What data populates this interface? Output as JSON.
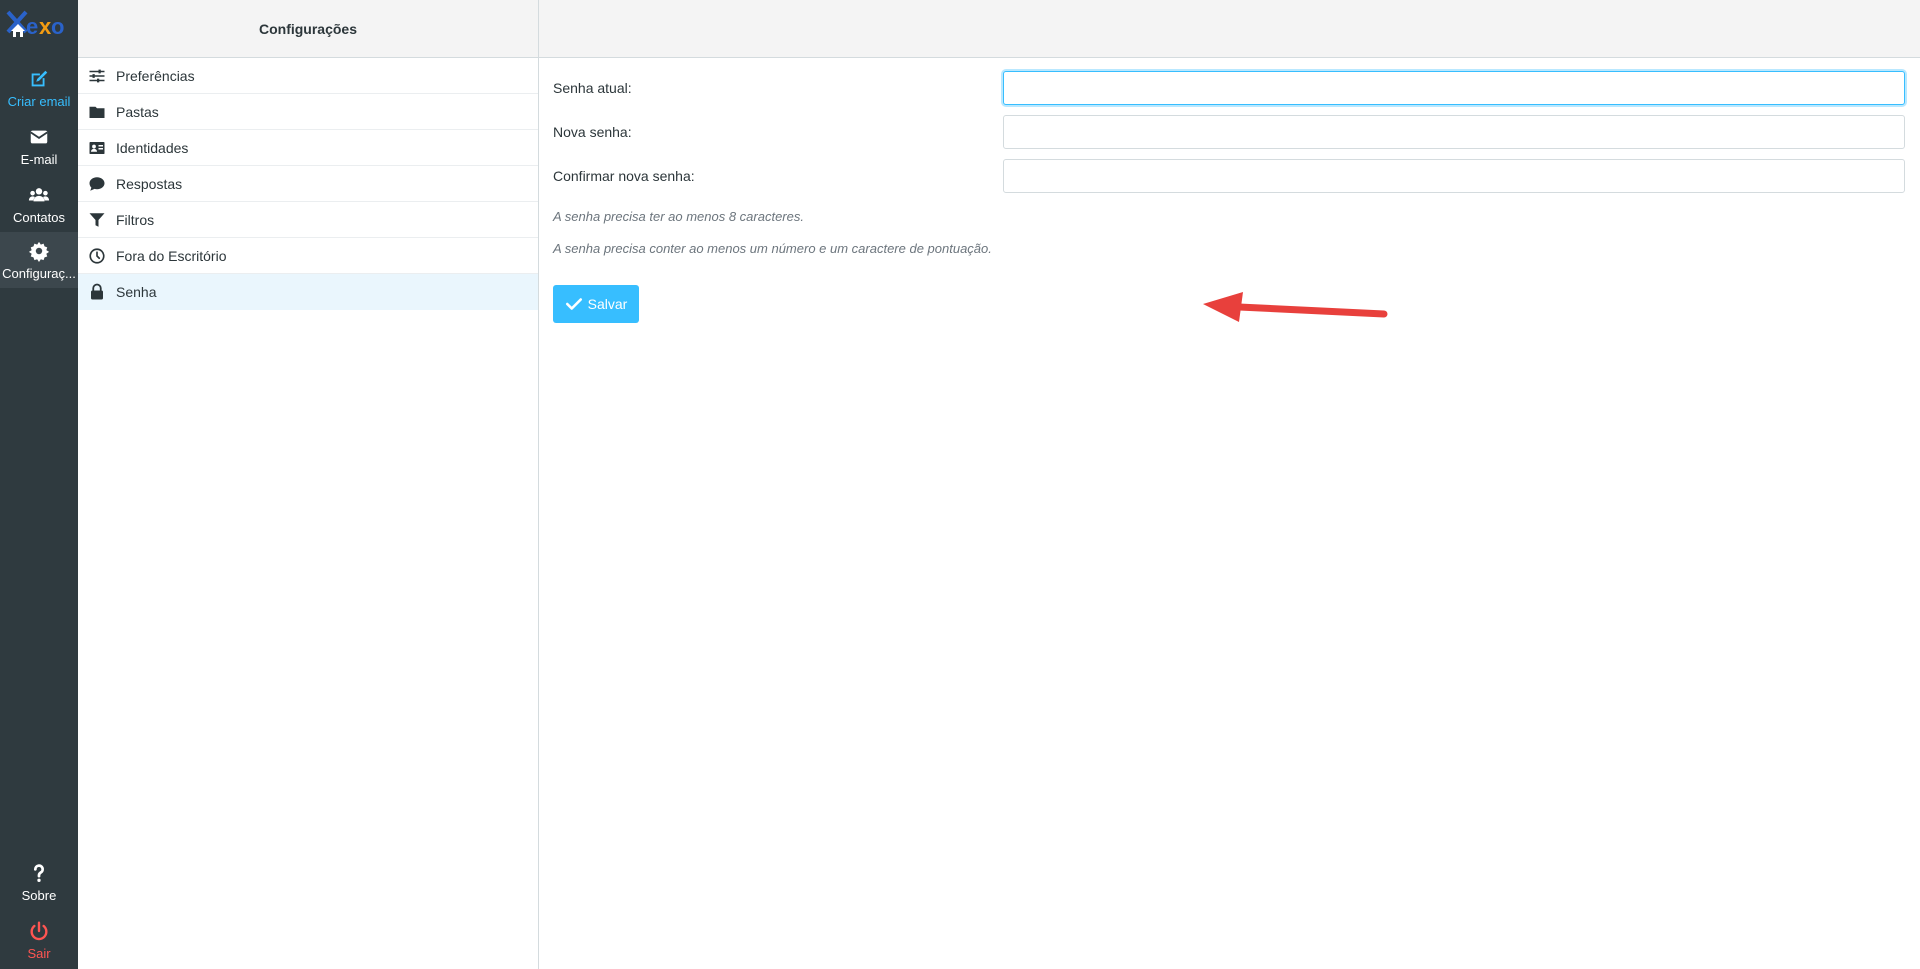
{
  "rail": {
    "items": [
      {
        "label": "Criar email",
        "icon": "compose-icon"
      },
      {
        "label": "E-mail",
        "icon": "envelope-icon"
      },
      {
        "label": "Contatos",
        "icon": "users-icon"
      },
      {
        "label": "Configuraç...",
        "icon": "gear-icon"
      }
    ],
    "bottom": [
      {
        "label": "Sobre",
        "icon": "question-icon"
      },
      {
        "label": "Sair",
        "icon": "power-icon"
      }
    ],
    "colors": {
      "background": "#2f3a3f",
      "accent": "#37beff",
      "logout": "#ff5552"
    }
  },
  "settings": {
    "title": "Configurações",
    "items": [
      {
        "label": "Preferências",
        "icon": "sliders-icon"
      },
      {
        "label": "Pastas",
        "icon": "folder-icon"
      },
      {
        "label": "Identidades",
        "icon": "id-card-icon"
      },
      {
        "label": "Respostas",
        "icon": "comment-icon"
      },
      {
        "label": "Filtros",
        "icon": "filter-icon"
      },
      {
        "label": "Fora do Escritório",
        "icon": "clock-icon"
      },
      {
        "label": "Senha",
        "icon": "lock-icon",
        "selected": true
      }
    ]
  },
  "form": {
    "current_password": {
      "label": "Senha atual:",
      "value": ""
    },
    "new_password": {
      "label": "Nova senha:",
      "value": ""
    },
    "confirm_password": {
      "label": "Confirmar nova senha:",
      "value": ""
    },
    "hints": [
      "A senha precisa ter ao menos 8 caracteres.",
      "A senha precisa conter ao menos um número e um caractere de pontuação."
    ],
    "save_label": "Salvar"
  }
}
